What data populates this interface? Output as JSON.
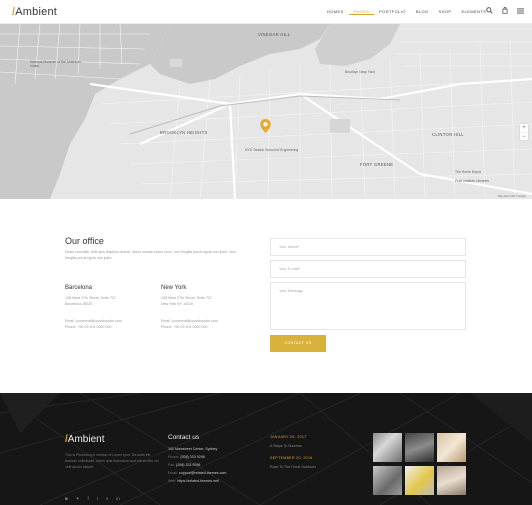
{
  "header": {
    "logo_text": "Ambient",
    "nav": [
      "HOMES",
      "PAGES",
      "PORTFOLIO",
      "BLOG",
      "SHOP",
      "ELEMENTS"
    ],
    "active_nav": "PAGES",
    "accent": "#d4a72c"
  },
  "map": {
    "labels": {
      "vinegar_hill": "VINEGAR HILL",
      "brooklyn_heights": "BROOKLYN HEIGHTS",
      "navy_yard": "Brooklyn Navy Yard",
      "museum": "National Museum of the American Indian",
      "nyu": "NYU Tandon School of Engineering",
      "clinton_hill": "CLINTON HILL",
      "fort_greene": "FORT GREENE",
      "pratt": "Pratt Institute Libraries",
      "home_depot": "The Home Depot"
    },
    "zoom_in": "+",
    "zoom_out": "−",
    "copyright": "Map data ©2017 Google"
  },
  "office": {
    "title": "Our office",
    "description": "Etiam convallis, felis quis dapibus dictum, libero mauris luctus nunc, non fringilla purus ligula non justo. Nun fringilla purus ligula non justo.",
    "locations": [
      {
        "city": "Barcelona",
        "address1": "108 West 27th Street, Suite 727",
        "address2": "Barcelona 28020",
        "email": "Email: youremail@yourdomain.com",
        "phone": "Phone: +90 03 101 0000 000"
      },
      {
        "city": "New York",
        "address1": "108 West 27th Street, Suite 727",
        "address2": "New York NY 10010",
        "email": "Email: youremail@yourdomain.com",
        "phone": "Phone: +90 03 101 0000 000"
      }
    ]
  },
  "form": {
    "name_placeholder": "Your Name*",
    "email_placeholder": "Your E-mail*",
    "message_placeholder": "Your Message",
    "submit_label": "CONTACT US",
    "button_color": "#d9b23c"
  },
  "footer": {
    "logo_text": "Ambient",
    "about": "This is Photoshop's version of Lorem Ipsn. Sit amet elit. Aenean sollicitudin, lorem quis bibendum auct elit at nibh vel velit auctor aliquet.",
    "social_icons": [
      "instagram-icon",
      "twitter-icon",
      "facebook-icon",
      "tumblr-icon",
      "vimeo-icon",
      "linkedin-icon"
    ],
    "contact_title": "Contact us",
    "address": "100 Mainstreet Center, Sydney",
    "phone_label": "Phone:",
    "phone": "(208) 333 9296",
    "fax_label": "Fax:",
    "fax": "(208) 333 9298",
    "email_label": "Email:",
    "email": "support@related-themes.com",
    "web_label": "Web:",
    "web": "https://related-themes.net/",
    "posts": [
      {
        "date": "JANUARY 26, 2017",
        "title": "A Steps To Success"
      },
      {
        "date": "SEPTEMBER 20, 2016",
        "title": "Race To The Great Outdoors"
      }
    ]
  }
}
